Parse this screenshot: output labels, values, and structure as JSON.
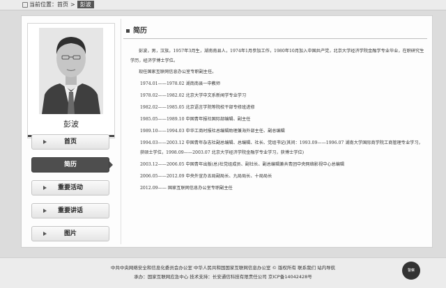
{
  "breadcrumb": {
    "prefix": "当前位置：",
    "home": "首页",
    "separator": ">",
    "current": "彭波"
  },
  "profile": {
    "name": "彭波"
  },
  "nav": {
    "items": [
      {
        "label": "首页",
        "active": false
      },
      {
        "label": "简历",
        "active": true
      },
      {
        "label": "重要活动",
        "active": false
      },
      {
        "label": "重要讲话",
        "active": false
      },
      {
        "label": "图片",
        "active": false
      }
    ]
  },
  "section": {
    "title": "简历"
  },
  "bio": {
    "intro": "彭波，男，汉族，1957年3月生，湖南南县人，1974年1月参加工作，1980年10月加入中国共产党，北京大学经济学院金融学专业毕业，在职研究生学历，经济学博士学位。",
    "current_post": "现任国家互联网信息办公室专职副主任。",
    "timeline": [
      "1974.01——1978.02 湖南南县一中教师",
      "1978.02——1982.02 北京大学中文系新闻学专业学习",
      "1982.02——1985.05 北京语言学院等院校干部专修班进修",
      "1985.05——1989.10 中国青年报社国际部编辑、副主任",
      "1989.10——1994.03 中华工商时报社总编辑助理兼海外部主任、副总编辑",
      "1994.03——2003.12 中国青年杂志社副总编辑、总编辑、社长、党组书记(其间：1993.09——1996.07 湖南大学国际商学院工商管理专业学习，获硕士学位，1998.09——2003.07 北京大学经济学院金融学专业学习，获博士学位)",
      "2003.12——2006.05 中国青年出版(总)社党组成员、副社长、副总编辑兼共青团中央网络影视中心总编辑",
      "2006.05——2012.09 中央外宣办五局副局长、九局局长、十局局长",
      "2012.09—— 国家互联网信息办公室专职副主任"
    ]
  },
  "footer": {
    "line1": "中共中央网络安全和信息化委员会办公室  中华人民共和国国家互联网信息办公室 © 版权所有  联系我们  站内导航",
    "line2": "承办：国家互联网应急中心  技术支持：长安通信科技有限责任公司  京ICP备14042428号",
    "badge": "警察"
  }
}
